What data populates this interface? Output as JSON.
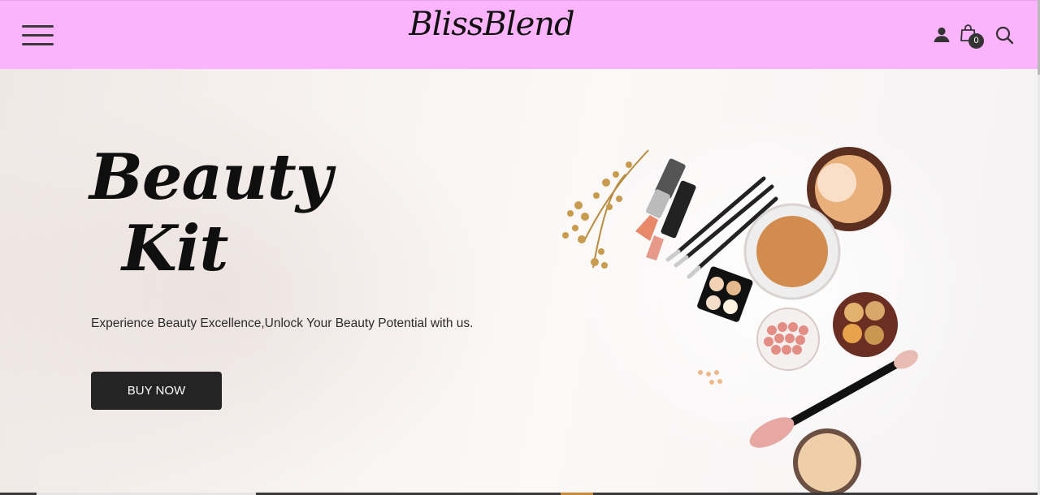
{
  "header": {
    "brand": "BlissBlend",
    "cart_count": "0",
    "icons": [
      "menu-icon",
      "user-icon",
      "shopping-bag-icon",
      "search-icon"
    ],
    "background_color": "#fbb3fb"
  },
  "hero": {
    "title_line1": "Beauty",
    "title_line2": "Kit",
    "tagline": "Experience Beauty Excellence,Unlock Your Beauty Potential with us.",
    "cta_label": "BUY NOW"
  }
}
